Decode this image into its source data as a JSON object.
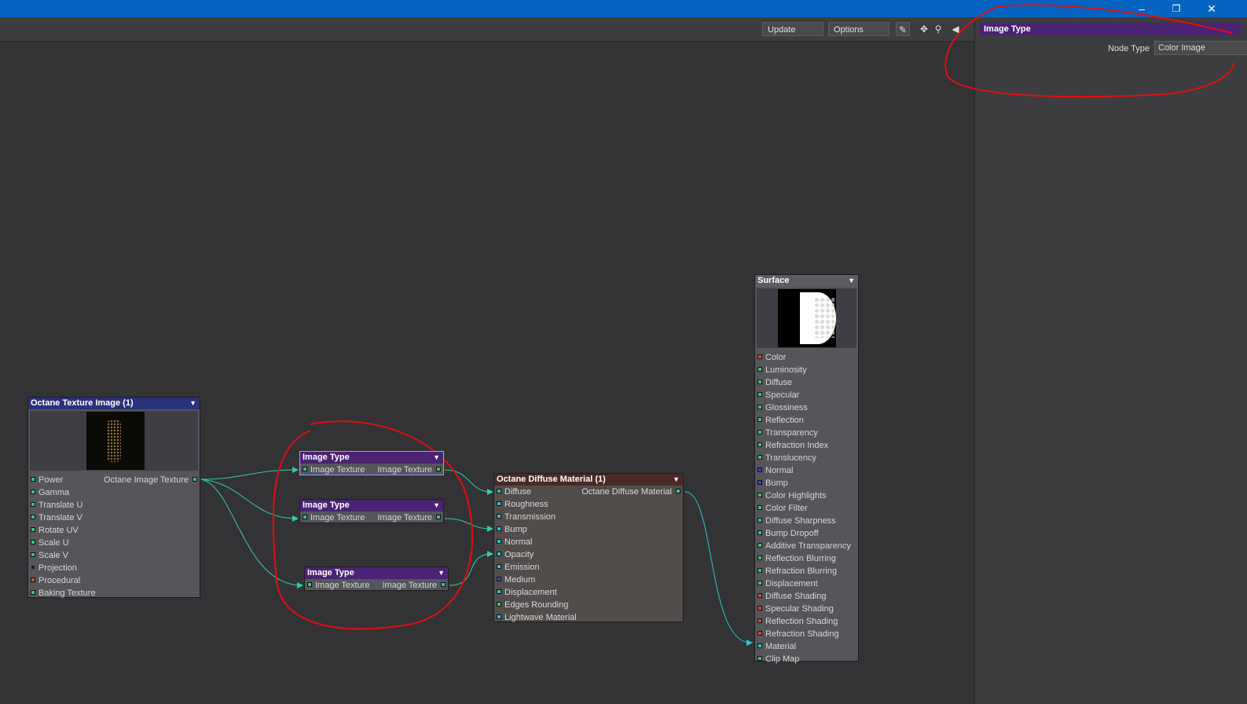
{
  "toolbar": {
    "update_label": "Update",
    "options_label": "Options"
  },
  "side_panel": {
    "header": "Image Type",
    "node_type_label": "Node Type",
    "node_type_value": "Color Image"
  },
  "nodes": {
    "texture": {
      "title": "Octane Texture Image (1)",
      "output": "Octane Image Texture",
      "inputs": [
        "Power",
        "Gamma",
        "Translate U",
        "Translate V",
        "Rotate UV",
        "Scale U",
        "Scale V",
        "Projection",
        "Procedural",
        "Baking Texture"
      ]
    },
    "image_type_1": {
      "title": "Image Type",
      "input": "Image Texture",
      "output": "Image Texture"
    },
    "image_type_2": {
      "title": "Image Type",
      "input": "Image Texture",
      "output": "Image Texture"
    },
    "image_type_3": {
      "title": "Image Type",
      "input": "Image Texture",
      "output": "Image Texture"
    },
    "diffuse": {
      "title": "Octane Diffuse Material (1)",
      "output": "Octane Diffuse Material",
      "inputs": [
        "Diffuse",
        "Roughness",
        "Transmission",
        "Bump",
        "Normal",
        "Opacity",
        "Emission",
        "Medium",
        "Displacement",
        "Edges Rounding",
        "Lightwave Material"
      ]
    },
    "surface": {
      "title": "Surface",
      "inputs": [
        "Color",
        "Luminosity",
        "Diffuse",
        "Specular",
        "Glossiness",
        "Reflection",
        "Transparency",
        "Refraction Index",
        "Translucency",
        "Normal",
        "Bump",
        "Color Highlights",
        "Color Filter",
        "Diffuse Sharpness",
        "Bump Dropoff",
        "Additive Transparency",
        "Reflection Blurring",
        "Refraction Blurring",
        "Displacement",
        "Diffuse Shading",
        "Specular Shading",
        "Reflection Shading",
        "Refraction Shading",
        "Material",
        "Clip Map"
      ]
    }
  },
  "colors": {
    "title_bar": "#0563c1",
    "image_type_header": "#4b2374",
    "texture_header": "#2a3278",
    "diffuse_header": "#4a2a24",
    "wire": "#2fd0a8",
    "annotation": "#e01010"
  },
  "icons": [
    "minimize-icon",
    "restore-icon",
    "close-icon",
    "pen-icon",
    "move-icon",
    "zoom-icon",
    "collapse-arrow-icon"
  ]
}
